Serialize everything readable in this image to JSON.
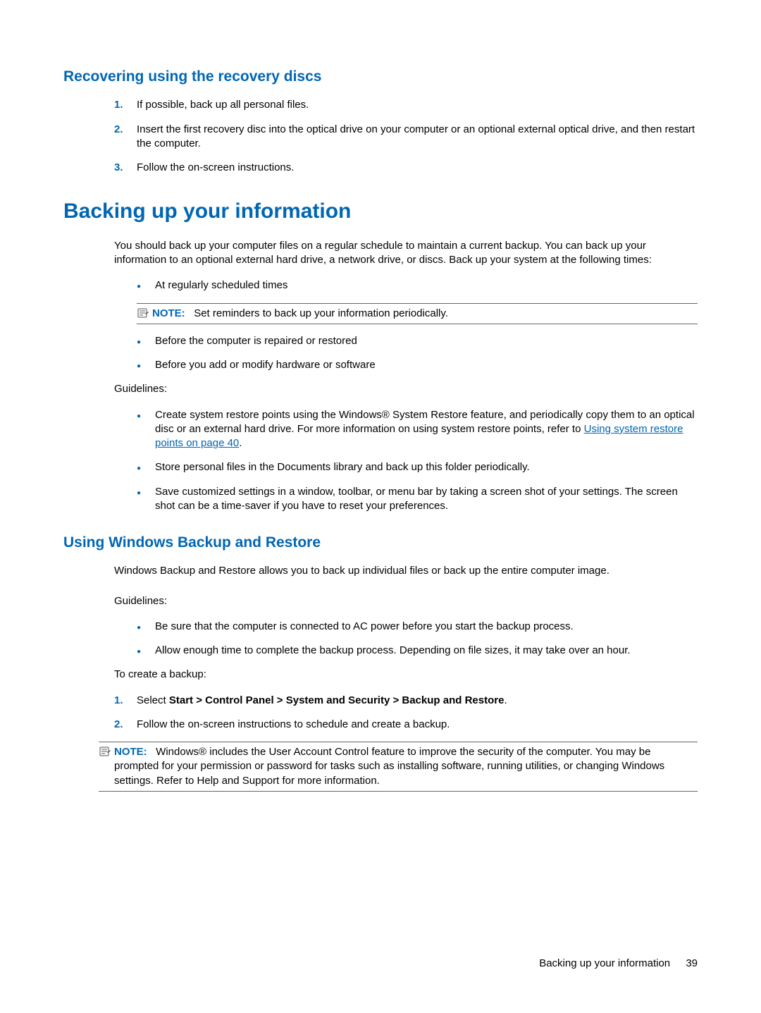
{
  "section1": {
    "heading": "Recovering using the recovery discs",
    "steps": [
      {
        "num": "1.",
        "text": "If possible, back up all personal files."
      },
      {
        "num": "2.",
        "text": "Insert the first recovery disc into the optical drive on your computer or an optional external optical drive, and then restart the computer."
      },
      {
        "num": "3.",
        "text": "Follow the on-screen instructions."
      }
    ]
  },
  "section2": {
    "heading": "Backing up your information",
    "intro": "You should back up your computer files on a regular schedule to maintain a current backup. You can back up your information to an optional external hard drive, a network drive, or discs. Back up your system at the following times:",
    "bullets_a": [
      "At regularly scheduled times"
    ],
    "note1_label": "NOTE:",
    "note1_text": "Set reminders to back up your information periodically.",
    "bullets_b": [
      "Before the computer is repaired or restored",
      "Before you add or modify hardware or software"
    ],
    "guidelines_label": "Guidelines:",
    "bullets_c_pre": "Create system restore points using the Windows® System Restore feature, and periodically copy them to an optical disc or an external hard drive. For more information on using system restore points, refer to ",
    "bullets_c_link": "Using system restore points on page 40",
    "bullets_c_post": ".",
    "bullets_d": [
      "Store personal files in the Documents library and back up this folder periodically.",
      "Save customized settings in a window, toolbar, or menu bar by taking a screen shot of your settings. The screen shot can be a time-saver if you have to reset your preferences."
    ]
  },
  "section3": {
    "heading": "Using Windows Backup and Restore",
    "intro": "Windows Backup and Restore allows you to back up individual files or back up the entire computer image.",
    "guidelines_label": "Guidelines:",
    "bullets": [
      "Be sure that the computer is connected to AC power before you start the backup process.",
      "Allow enough time to complete the backup process. Depending on file sizes, it may take over an hour."
    ],
    "create_label": "To create a backup:",
    "steps": [
      {
        "num": "1.",
        "pre": "Select ",
        "bold": "Start > Control Panel > System and Security > Backup and Restore",
        "post": "."
      },
      {
        "num": "2.",
        "pre": "Follow the on-screen instructions to schedule and create a backup.",
        "bold": "",
        "post": ""
      }
    ],
    "note2_label": "NOTE:",
    "note2_text": "Windows® includes the User Account Control feature to improve the security of the computer. You may be prompted for your permission or password for tasks such as installing software, running utilities, or changing Windows settings. Refer to Help and Support for more information."
  },
  "footer": {
    "text": "Backing up your information",
    "page": "39"
  }
}
